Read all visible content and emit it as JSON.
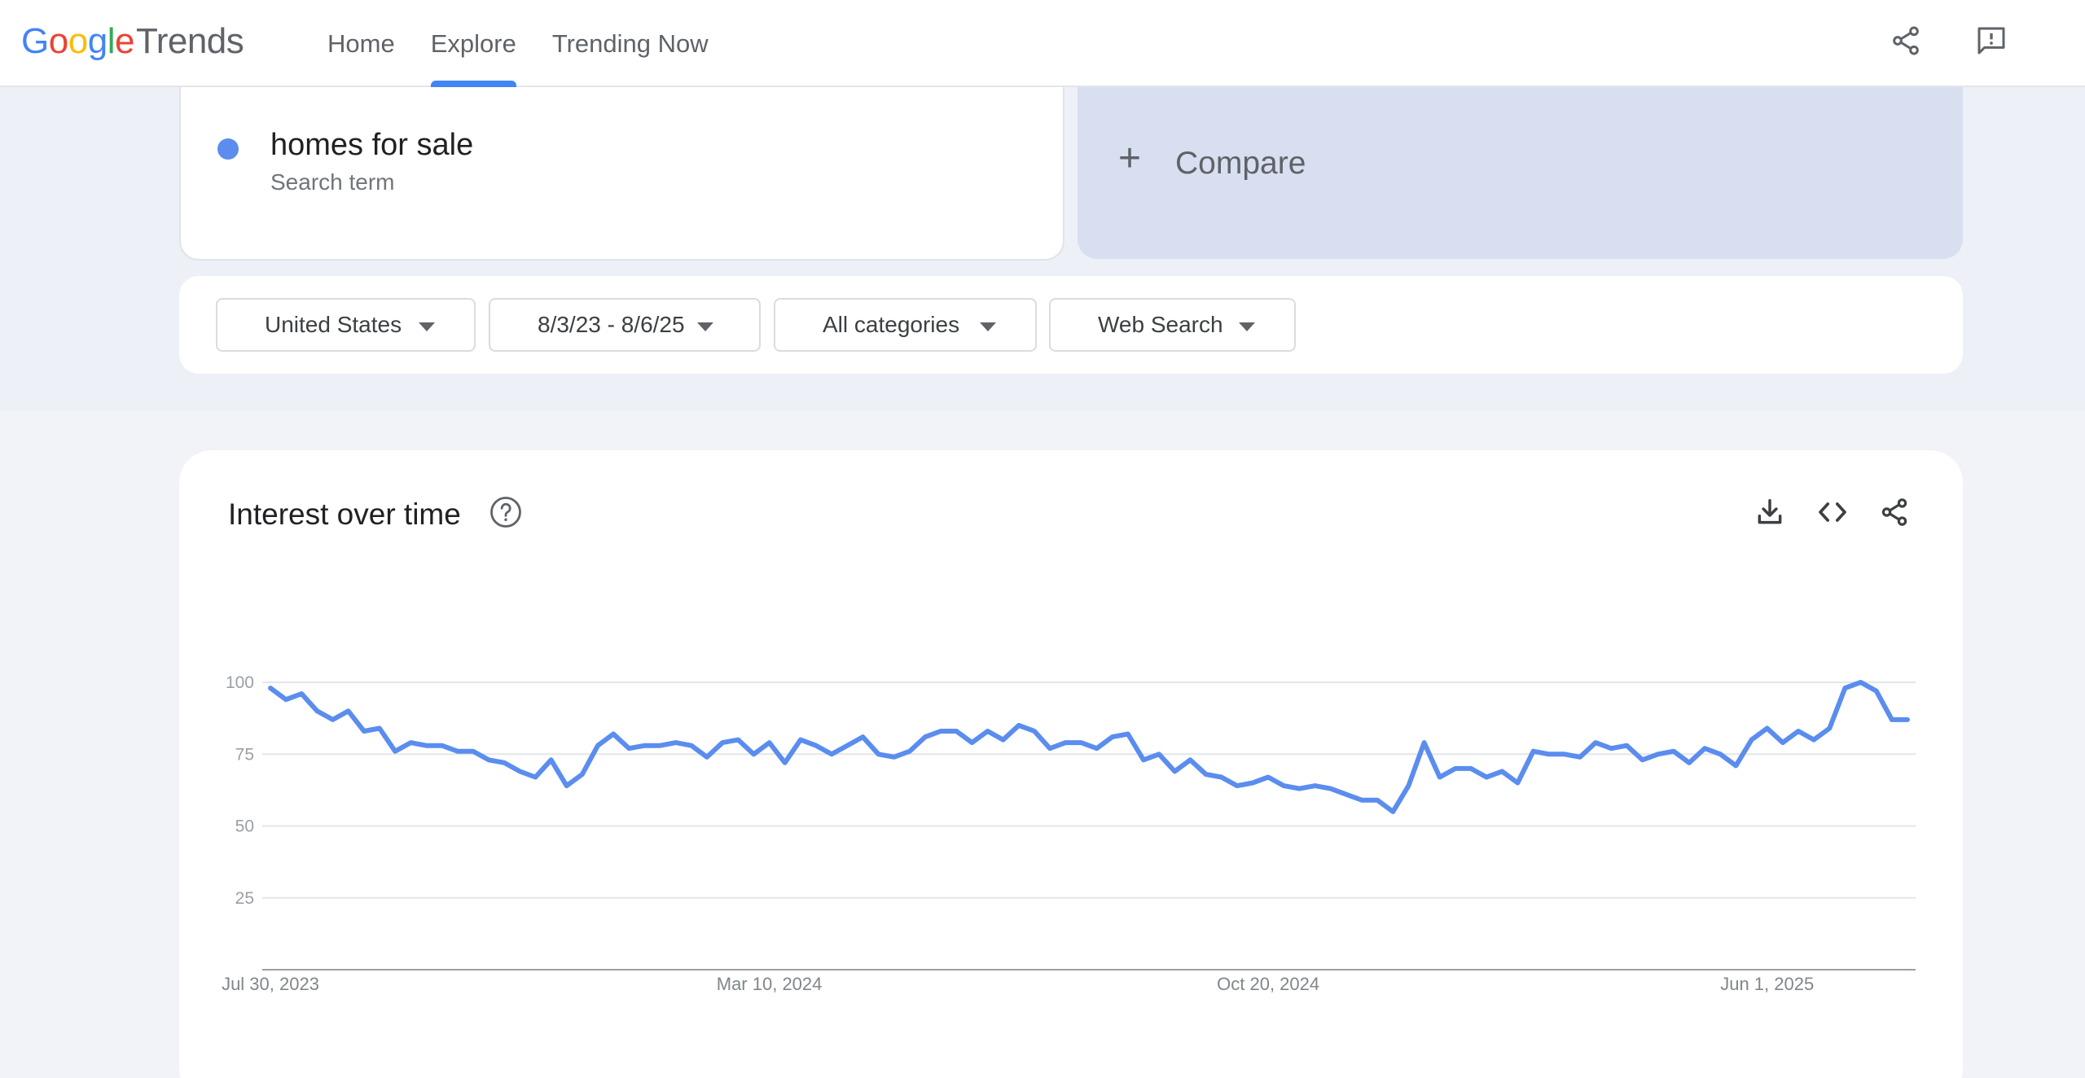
{
  "header": {
    "logo": {
      "g1": "G",
      "g2": "o",
      "g3": "o",
      "g4": "g",
      "g5": "l",
      "g6": "e",
      "trends": "Trends"
    },
    "nav": [
      {
        "label": "Home",
        "active": false
      },
      {
        "label": "Explore",
        "active": true
      },
      {
        "label": "Trending Now",
        "active": false
      }
    ],
    "icons": [
      "share-icon",
      "feedback-icon"
    ]
  },
  "search": {
    "term": "homes for sale",
    "term_type": "Search term",
    "term_color": "#5b8def",
    "compare_label": "Compare"
  },
  "filters": {
    "region": "United States",
    "date_range": "8/3/23 - 8/6/25",
    "category": "All categories",
    "search_type": "Web Search"
  },
  "chart_section": {
    "title": "Interest over time",
    "icons": [
      "help-icon",
      "download-icon",
      "embed-code-icon",
      "share-icon"
    ]
  },
  "chart_data": {
    "type": "line",
    "title": "",
    "xlabel": "",
    "ylabel": "",
    "ylim": [
      0,
      100
    ],
    "y_ticks": [
      "25",
      "50",
      "75",
      "100"
    ],
    "x_tick_labels": [
      "Jul 30, 2023",
      "Mar 10, 2024",
      "Oct 20, 2024",
      "Jun 1, 2025"
    ],
    "x_tick_index": [
      0,
      32,
      64,
      96
    ],
    "grid": true,
    "series": [
      {
        "name": "homes for sale",
        "color": "#5b8def",
        "values": [
          98,
          94,
          96,
          90,
          87,
          90,
          83,
          84,
          76,
          79,
          78,
          78,
          76,
          76,
          73,
          72,
          69,
          67,
          73,
          64,
          68,
          78,
          82,
          77,
          78,
          78,
          79,
          78,
          74,
          79,
          80,
          75,
          79,
          72,
          80,
          78,
          75,
          78,
          81,
          75,
          74,
          76,
          81,
          83,
          83,
          79,
          83,
          80,
          85,
          83,
          77,
          79,
          79,
          77,
          81,
          82,
          73,
          75,
          69,
          73,
          68,
          67,
          64,
          65,
          67,
          64,
          63,
          64,
          63,
          61,
          59,
          59,
          55,
          64,
          79,
          67,
          70,
          70,
          67,
          69,
          65,
          76,
          75,
          75,
          74,
          79,
          77,
          78,
          73,
          75,
          76,
          72,
          77,
          75,
          71,
          80,
          84,
          79,
          83,
          80,
          84,
          98,
          100,
          97,
          87,
          87
        ]
      }
    ]
  }
}
